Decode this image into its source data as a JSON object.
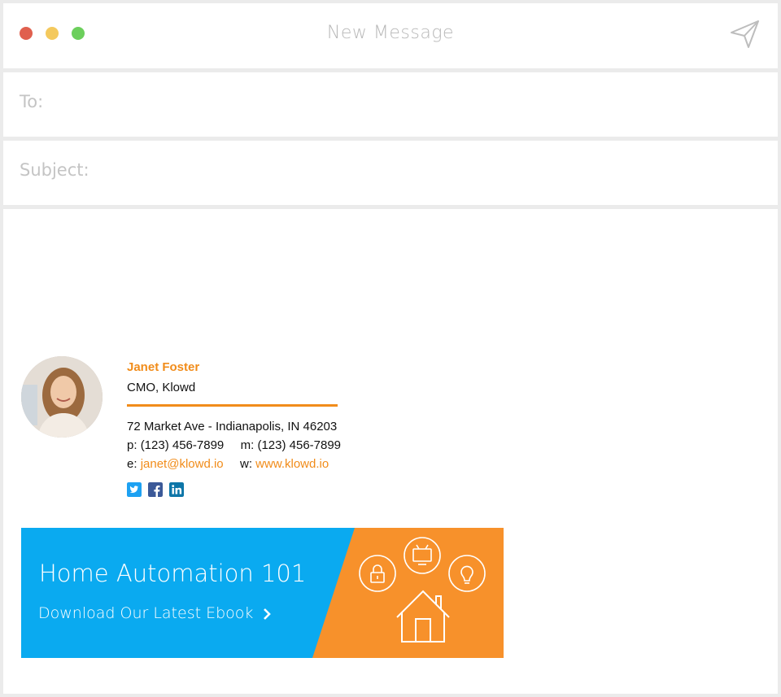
{
  "window": {
    "title": "New Message",
    "traffic_colors": {
      "close": "#e0604e",
      "minimize": "#f4c95d",
      "maximize": "#6ccf5c"
    },
    "send_icon": "paper-plane-icon"
  },
  "compose": {
    "to_label": "To:",
    "to_value": "",
    "subject_label": "Subject:",
    "subject_value": ""
  },
  "signature": {
    "name": "Janet Foster",
    "role": "CMO, Klowd",
    "address": "72 Market Ave - Indianapolis, IN 46203",
    "phone_label": "p:",
    "phone": "(123) 456-7899",
    "mobile_label": "m:",
    "mobile": "(123) 456-7899",
    "email_label": "e:",
    "email": "janet@klowd.io",
    "web_label": "w:",
    "web": "www.klowd.io",
    "accent_color": "#f18c1a",
    "social": [
      {
        "icon": "twitter-icon",
        "color": "#1da1f2"
      },
      {
        "icon": "facebook-icon",
        "color": "#3b5998"
      },
      {
        "icon": "linkedin-icon",
        "color": "#0e76a8"
      }
    ]
  },
  "banner": {
    "title": "Home Automation 101",
    "cta": "Download Our Latest Ebook",
    "blue": "#0aaaf0",
    "orange": "#f7912b",
    "icons": [
      "lock-icon",
      "tv-icon",
      "lightbulb-icon",
      "house-icon"
    ]
  }
}
